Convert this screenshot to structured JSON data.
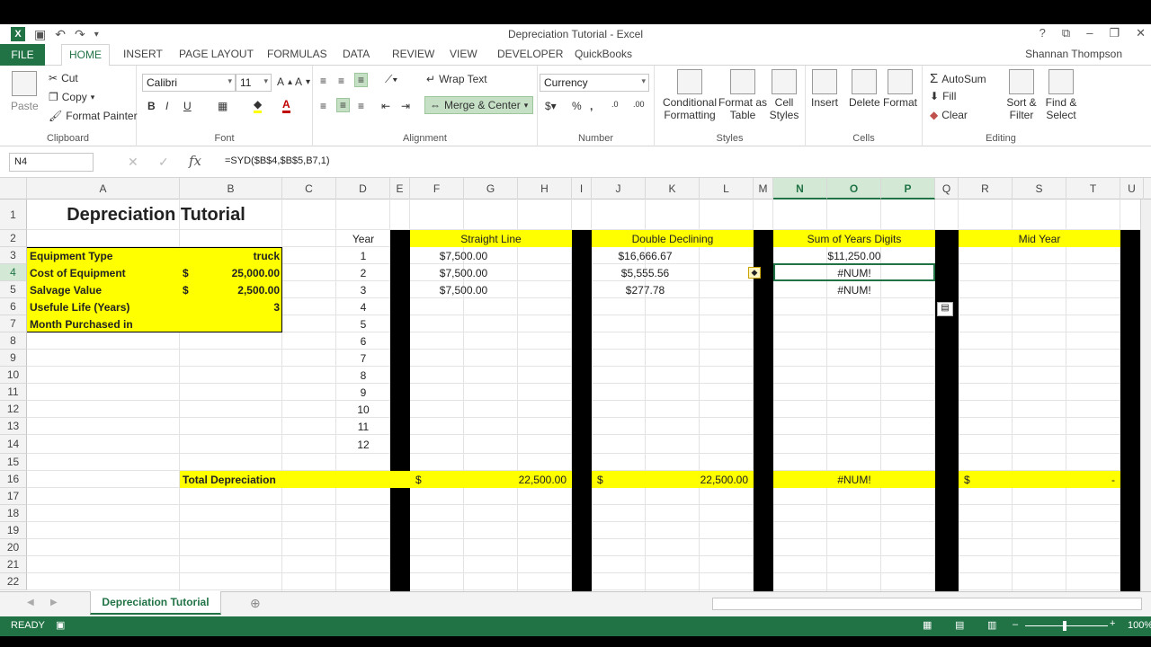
{
  "window": {
    "title": "Depreciation Tutorial - Excel",
    "user": "Shannan Thompson"
  },
  "tabs": [
    "FILE",
    "HOME",
    "INSERT",
    "PAGE LAYOUT",
    "FORMULAS",
    "DATA",
    "REVIEW",
    "VIEW",
    "DEVELOPER",
    "QuickBooks"
  ],
  "ribbon": {
    "clipboard": {
      "label": "Clipboard",
      "paste": "Paste",
      "cut": "Cut",
      "copy": "Copy",
      "format_painter": "Format Painter"
    },
    "font": {
      "label": "Font",
      "name": "Calibri",
      "size": "11"
    },
    "alignment": {
      "label": "Alignment",
      "wrap": "Wrap Text",
      "merge": "Merge & Center"
    },
    "number": {
      "label": "Number",
      "format": "Currency"
    },
    "styles": {
      "label": "Styles",
      "cond": "Conditional Formatting",
      "table": "Format as Table",
      "cell": "Cell Styles"
    },
    "cells": {
      "label": "Cells",
      "insert": "Insert",
      "delete": "Delete",
      "format": "Format"
    },
    "editing": {
      "label": "Editing",
      "autosum": "AutoSum",
      "fill": "Fill",
      "clear": "Clear",
      "sort": "Sort & Filter",
      "find": "Find & Select"
    }
  },
  "formula_bar": {
    "name_box": "N4",
    "formula": "=SYD($B$4,$B$5,B7,1)"
  },
  "columns": [
    "A",
    "B",
    "C",
    "D",
    "E",
    "F",
    "G",
    "H",
    "I",
    "J",
    "K",
    "L",
    "M",
    "N",
    "O",
    "P",
    "Q",
    "R",
    "S",
    "T",
    "U"
  ],
  "rows": [
    "1",
    "2",
    "3",
    "4",
    "5",
    "6",
    "7",
    "8",
    "9",
    "10",
    "11",
    "12",
    "13",
    "14",
    "15",
    "16",
    "17",
    "18",
    "19",
    "20",
    "21",
    "22"
  ],
  "sheet": {
    "title": "Depreciation Tutorial",
    "inputs": [
      {
        "label": "Equipment Type",
        "cur": "",
        "value": "truck"
      },
      {
        "label": "Cost of Equipment",
        "cur": "$",
        "value": "25,000.00"
      },
      {
        "label": "Salvage Value",
        "cur": "$",
        "value": "2,500.00"
      },
      {
        "label": "Usefule Life (Years)",
        "cur": "",
        "value": "3"
      },
      {
        "label": "Month Purchased in",
        "cur": "",
        "value": ""
      }
    ],
    "year_header": "Year",
    "years": [
      "1",
      "2",
      "3",
      "4",
      "5",
      "6",
      "7",
      "8",
      "9",
      "10",
      "11",
      "12"
    ],
    "headers": {
      "sl": "Straight Line",
      "ddb": "Double Declining",
      "syd": "Sum of Years Digits",
      "mid": "Mid Year"
    },
    "straight_line": [
      "$7,500.00",
      "$7,500.00",
      "$7,500.00"
    ],
    "double_declining": [
      "$16,666.67",
      "$5,555.56",
      "$277.78"
    ],
    "sum_of_years": [
      "$11,250.00",
      "#NUM!",
      "#NUM!"
    ],
    "total": {
      "label": "Total Depreciation",
      "sl_cur": "$",
      "sl": "22,500.00",
      "ddb_cur": "$",
      "ddb": "22,500.00",
      "syd": "#NUM!",
      "mid_cur": "$",
      "mid": "-"
    }
  },
  "sheet_tab": "Depreciation Tutorial",
  "status": {
    "ready": "READY",
    "zoom": "100%"
  }
}
